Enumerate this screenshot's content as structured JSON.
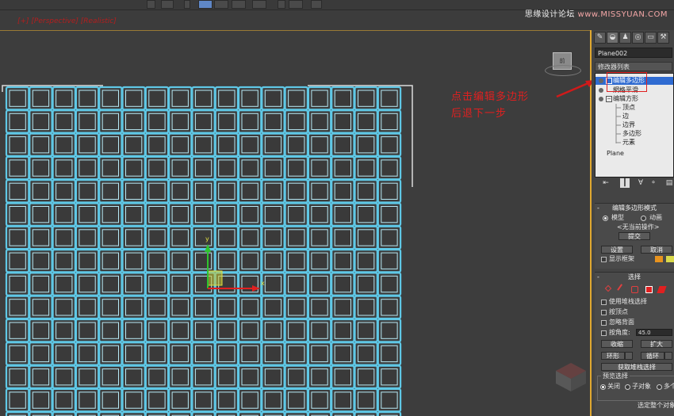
{
  "watermark": {
    "brand": "思缘设计论坛",
    "site": "www.MISSYUAN.COM"
  },
  "viewport": {
    "label": "[+] [Perspective] [Realistic]",
    "grid": {
      "cols": 17,
      "rows": 14
    },
    "gizmo": {
      "x_label": "x",
      "y_label": "y"
    },
    "viewcube_label": "前"
  },
  "annotation": {
    "line1": "点击编辑多边形",
    "line2": "后退下一步"
  },
  "panel": {
    "tabs": [
      "✎",
      "◒",
      "♟",
      "◎",
      "▭",
      "⚒"
    ],
    "object_name": "Plane002",
    "modifier_list": "修改器列表",
    "stack": [
      {
        "label": "编辑多边形",
        "selected": true
      },
      {
        "label": "網格平滑",
        "selected": false
      },
      {
        "label": "编辑方形",
        "selected": false
      },
      {
        "label": "顶点",
        "selected": false
      },
      {
        "label": "边",
        "selected": false
      },
      {
        "label": "边界",
        "selected": false
      },
      {
        "label": "多边形",
        "selected": false
      },
      {
        "label": "元素",
        "selected": false
      },
      {
        "label": "Plane",
        "selected": false
      }
    ],
    "stack_tools": [
      "⇤",
      "┃",
      "∀",
      "⚬",
      "▤"
    ],
    "edit_mode": {
      "title": "编辑多边形模式",
      "model": "模型",
      "animate": "动画",
      "no_op": "<无当前操作>",
      "commit": "提交",
      "settings": "设置",
      "cancel": "取消",
      "show_cage": "显示框架",
      "cage_colors": [
        "#e8931e",
        "#d9d94a"
      ]
    },
    "selection": {
      "title": "选择",
      "use_stack": "使用堆栈选择",
      "by_vertex": "按顶点",
      "ignore_backfacing": "忽略背面",
      "by_angle": "按角度:",
      "angle_value": "45.0",
      "shrink": "收缩",
      "grow": "扩大",
      "ring": "环形",
      "loop": "循环",
      "get_stack": "获取堆栈选择",
      "preview": "预览选择",
      "off": "关闭",
      "sub_object": "子对象",
      "multi": "多个",
      "status": "选定整个对象"
    }
  }
}
